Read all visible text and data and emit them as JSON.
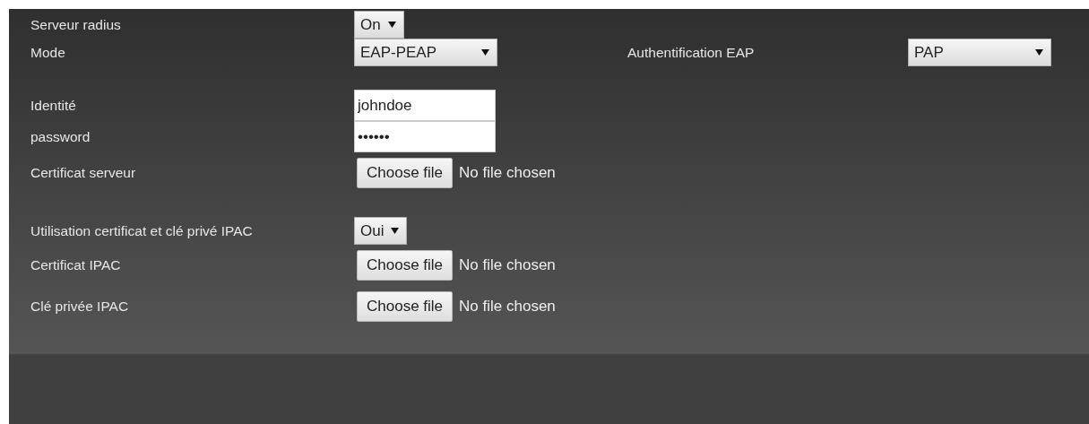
{
  "groups": [
    {
      "rows": [
        {
          "label": "Serveur radius",
          "control": {
            "kind": "select",
            "value": "On"
          }
        },
        {
          "label": "Mode",
          "control": {
            "kind": "select",
            "value": "EAP-PEAP"
          },
          "extra": {
            "label": "Authentification EAP",
            "control": {
              "kind": "select",
              "value": "PAP"
            }
          }
        }
      ]
    },
    {
      "rows": [
        {
          "label": "Identité",
          "control": {
            "kind": "text",
            "value": "johndoe"
          }
        },
        {
          "label": "password",
          "control": {
            "kind": "password",
            "value": "••••••"
          }
        },
        {
          "label": "Certificat serveur",
          "control": {
            "kind": "file",
            "button": "Choose file",
            "status": "No file chosen"
          }
        }
      ]
    },
    {
      "rows": [
        {
          "label": "Utilisation certificat et clé privé IPAC",
          "control": {
            "kind": "select",
            "value": "Oui"
          }
        },
        {
          "label": "Certificat IPAC",
          "control": {
            "kind": "file",
            "button": "Choose file",
            "status": "No file chosen"
          }
        },
        {
          "label": "Clé privée IPAC",
          "control": {
            "kind": "file",
            "button": "Choose file",
            "status": "No file chosen"
          }
        }
      ]
    }
  ]
}
